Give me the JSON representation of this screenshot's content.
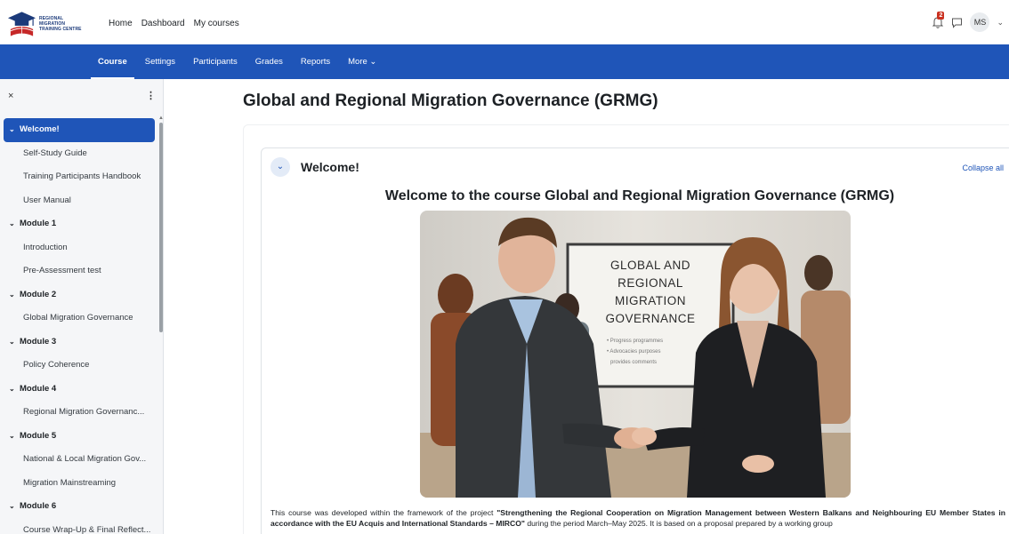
{
  "brand": {
    "logo_line1": "REGIONAL MIGRATION",
    "logo_line2": "TRAINING CENTRE"
  },
  "topnav": {
    "home": "Home",
    "dashboard": "Dashboard",
    "my_courses": "My courses"
  },
  "user": {
    "notification_count": "2",
    "initials": "MS"
  },
  "secondary_nav": [
    {
      "label": "Course"
    },
    {
      "label": "Settings"
    },
    {
      "label": "Participants"
    },
    {
      "label": "Grades"
    },
    {
      "label": "Reports"
    },
    {
      "label": "More ⌄"
    }
  ],
  "sidebar": {
    "close": "×",
    "menu": "⋮",
    "items": [
      {
        "label": "Welcome!",
        "type": "section",
        "active": true
      },
      {
        "label": "Self-Study Guide",
        "type": "item"
      },
      {
        "label": "Training Participants Handbook",
        "type": "item"
      },
      {
        "label": "User Manual",
        "type": "item"
      },
      {
        "label": "Module 1",
        "type": "section"
      },
      {
        "label": "Introduction",
        "type": "item"
      },
      {
        "label": "Pre-Assessment test",
        "type": "item"
      },
      {
        "label": "Module 2",
        "type": "section"
      },
      {
        "label": "Global Migration Governance",
        "type": "item"
      },
      {
        "label": "Module 3",
        "type": "section"
      },
      {
        "label": "Policy Coherence",
        "type": "item"
      },
      {
        "label": "Module 4",
        "type": "section"
      },
      {
        "label": "Regional Migration Governanc...",
        "type": "item"
      },
      {
        "label": "Module 5",
        "type": "section"
      },
      {
        "label": "National & Local Migration Gov...",
        "type": "item"
      },
      {
        "label": "Migration Mainstreaming",
        "type": "item"
      },
      {
        "label": "Module 6",
        "type": "section"
      },
      {
        "label": "Course Wrap-Up & Final Reflect...",
        "type": "item"
      }
    ]
  },
  "main": {
    "page_title": "Global and Regional Migration Governance (GRMG)",
    "section_title": "Welcome!",
    "collapse_all": "Collapse all",
    "welcome_heading": "Welcome to the course Global and Regional Migration Governance (GRMG)",
    "board": {
      "lines": [
        "GLOBAL AND",
        "REGIONAL",
        "MIGRATION",
        "GOVERNANCE"
      ],
      "bullets": [
        "• Progress programmes",
        "• Advocacies purposes",
        "provides comments"
      ]
    },
    "intro": {
      "p1": "This course was developed within the framework of the project ",
      "project_name": "\"Strengthening the Regional Cooperation on Migration Management between Western Balkans and Neighbouring EU Member States in accordance with the EU Acquis and International Standards – MIRCO\"",
      "p2": " during the period March–May 2025. It is based on a proposal prepared by a working group"
    }
  },
  "colors": {
    "brand_blue": "#1f55b8",
    "badge_red": "#ca3120"
  }
}
